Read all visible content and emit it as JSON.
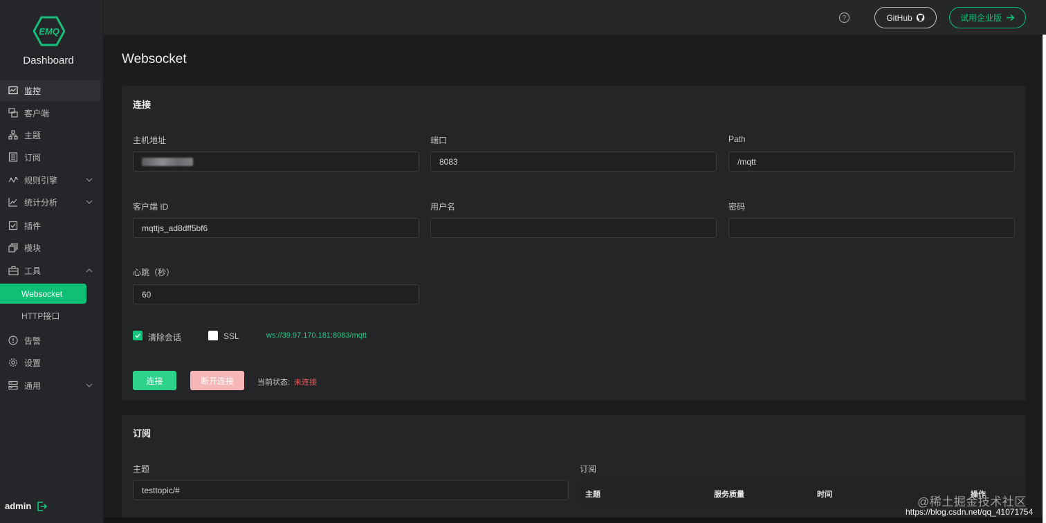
{
  "sidebar": {
    "logo_text": "EMQ",
    "brand": "Dashboard",
    "items": [
      {
        "label": "监控",
        "icon": "monitor-icon"
      },
      {
        "label": "客户端",
        "icon": "clients-icon"
      },
      {
        "label": "主题",
        "icon": "topics-icon"
      },
      {
        "label": "订阅",
        "icon": "subscriptions-icon"
      },
      {
        "label": "规则引擎",
        "icon": "rule-engine-icon"
      },
      {
        "label": "统计分析",
        "icon": "analytics-icon"
      },
      {
        "label": "插件",
        "icon": "plugins-icon"
      },
      {
        "label": "模块",
        "icon": "modules-icon"
      },
      {
        "label": "工具",
        "icon": "tools-icon"
      },
      {
        "label": "告警",
        "icon": "alarm-icon"
      },
      {
        "label": "设置",
        "icon": "settings-icon"
      },
      {
        "label": "通用",
        "icon": "general-icon"
      }
    ],
    "tools_children": [
      {
        "label": "Websocket"
      },
      {
        "label": "HTTP接口"
      }
    ],
    "user": "admin"
  },
  "topbar": {
    "github_label": "GitHub",
    "enterprise_label": "试用企业版"
  },
  "page": {
    "title": "Websocket"
  },
  "connection": {
    "title": "连接",
    "host_label": "主机地址",
    "port_label": "端口",
    "port_value": "8083",
    "path_label": "Path",
    "path_value": "/mqtt",
    "client_id_label": "客户端 ID",
    "client_id_value": "mqttjs_ad8dff5bf6",
    "username_label": "用户名",
    "username_value": "",
    "password_label": "密码",
    "password_value": "",
    "keepalive_label": "心跳（秒）",
    "keepalive_value": "60",
    "clean_session_label": "清除会话",
    "clean_session_checked": true,
    "ssl_label": "SSL",
    "ssl_checked": false,
    "ws_url": "ws://39.97.170.181:8083/mqtt",
    "connect_label": "连接",
    "disconnect_label": "断开连接",
    "status_label": "当前状态:",
    "status_value": "未连接"
  },
  "subscribe": {
    "title": "订阅",
    "topic_label": "主题",
    "topic_value": "testtopic/#",
    "list_label": "订阅",
    "columns": [
      "主题",
      "服务质量",
      "时间",
      "操作"
    ]
  },
  "watermark": {
    "line1": "@稀土掘金技术社区",
    "line2": "https://blog.csdn.net/qq_41071754"
  },
  "colors": {
    "accent": "#0fbf75",
    "danger": "#ef5a5a",
    "sidebar_bg": "#252629",
    "content_bg": "#1c1c1d"
  }
}
